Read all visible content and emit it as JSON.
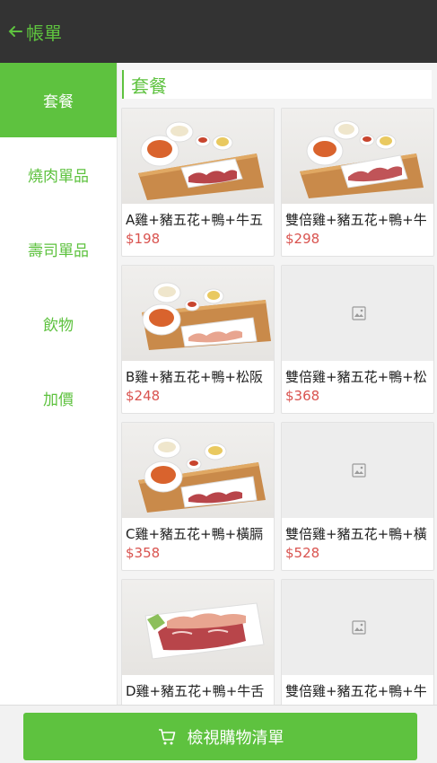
{
  "header": {
    "title": "帳單"
  },
  "sidebar": {
    "items": [
      {
        "label": "套餐",
        "active": true
      },
      {
        "label": "燒肉單品",
        "active": false
      },
      {
        "label": "壽司單品",
        "active": false
      },
      {
        "label": "飲物",
        "active": false
      },
      {
        "label": "加價",
        "active": false
      }
    ]
  },
  "section": {
    "title": "套餐"
  },
  "products": [
    {
      "name": "A雞+豬五花+鴨+牛五",
      "price": "$198",
      "image": "photo-set"
    },
    {
      "name": "雙倍雞+豬五花+鴨+牛",
      "price": "$298",
      "image": "photo-set"
    },
    {
      "name": "B雞+豬五花+鴨+松阪",
      "price": "$248",
      "image": "photo-set"
    },
    {
      "name": "雙倍雞+豬五花+鴨+松",
      "price": "$368",
      "image": "placeholder"
    },
    {
      "name": "C雞+豬五花+鴨+橫膈",
      "price": "$358",
      "image": "photo-set"
    },
    {
      "name": "雙倍雞+豬五花+鴨+橫",
      "price": "$528",
      "image": "placeholder"
    },
    {
      "name": "D雞+豬五花+鴨+牛舌",
      "price": "",
      "image": "photo-platter"
    },
    {
      "name": "雙倍雞+豬五花+鴨+牛",
      "price": "",
      "image": "placeholder"
    }
  ],
  "footer": {
    "cart_label": "檢視購物清單"
  },
  "colors": {
    "accent": "#5ec23f",
    "price": "#d9534f",
    "header_bg": "#333333"
  }
}
